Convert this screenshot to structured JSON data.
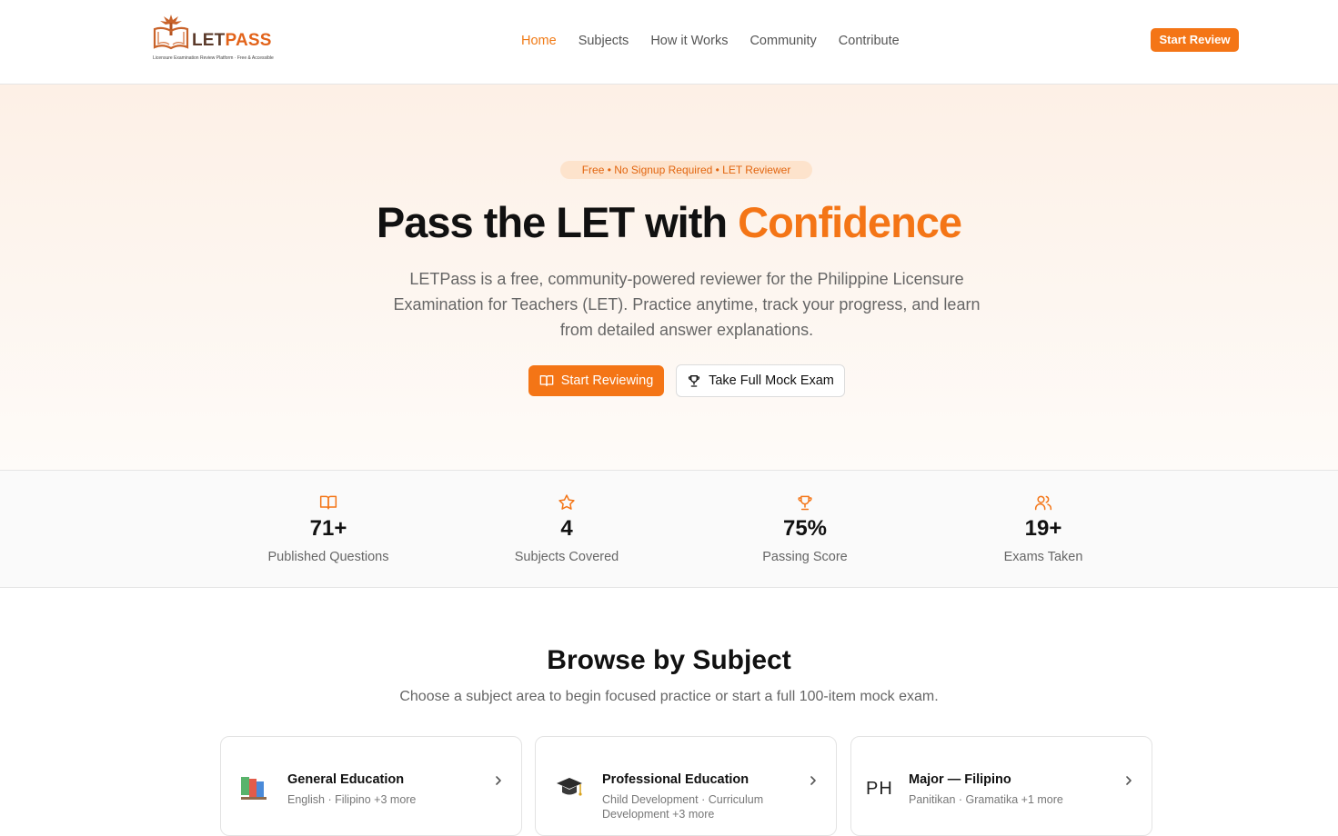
{
  "brand": {
    "name_part1": "LET",
    "name_part2": "PASS",
    "tagline": "Licensure Examination Review Platform · Free & Accessible"
  },
  "nav": {
    "items": [
      "Home",
      "Subjects",
      "How it Works",
      "Community",
      "Contribute"
    ],
    "active": "Home"
  },
  "header": {
    "cta_label": "Start Review"
  },
  "hero": {
    "pill": "Free • No Signup Required • LET Reviewer",
    "title_plain": "Pass the LET with ",
    "title_accent": "Confidence",
    "description": "LETPass is a free, community-powered reviewer for the Philippine Licensure Examination for Teachers (LET). Practice anytime, track your progress, and learn from detailed answer explanations.",
    "primary_button": "Start Reviewing",
    "secondary_button": "Take Full Mock Exam"
  },
  "stats": [
    {
      "icon": "book-open-icon",
      "value": "71+",
      "label": "Published Questions"
    },
    {
      "icon": "star-icon",
      "value": "4",
      "label": "Subjects Covered"
    },
    {
      "icon": "trophy-icon",
      "value": "75%",
      "label": "Passing Score"
    },
    {
      "icon": "users-icon",
      "value": "19+",
      "label": "Exams Taken"
    }
  ],
  "browse": {
    "title": "Browse by Subject",
    "subtitle": "Choose a subject area to begin focused practice or start a full 100-item mock exam.",
    "cards": [
      {
        "icon": "books-icon",
        "title": "General Education",
        "subtitle": "English · Filipino +3 more"
      },
      {
        "icon": "graduation-cap-icon",
        "title": "Professional Education",
        "subtitle": "Child Development · Curriculum Development +3 more"
      },
      {
        "icon_text": "PH",
        "title": "Major — Filipino",
        "subtitle": "Panitikan · Gramatika +1 more"
      }
    ]
  },
  "colors": {
    "accent": "#f47516",
    "pill_bg": "#fde3cc",
    "text_muted": "#666666"
  }
}
